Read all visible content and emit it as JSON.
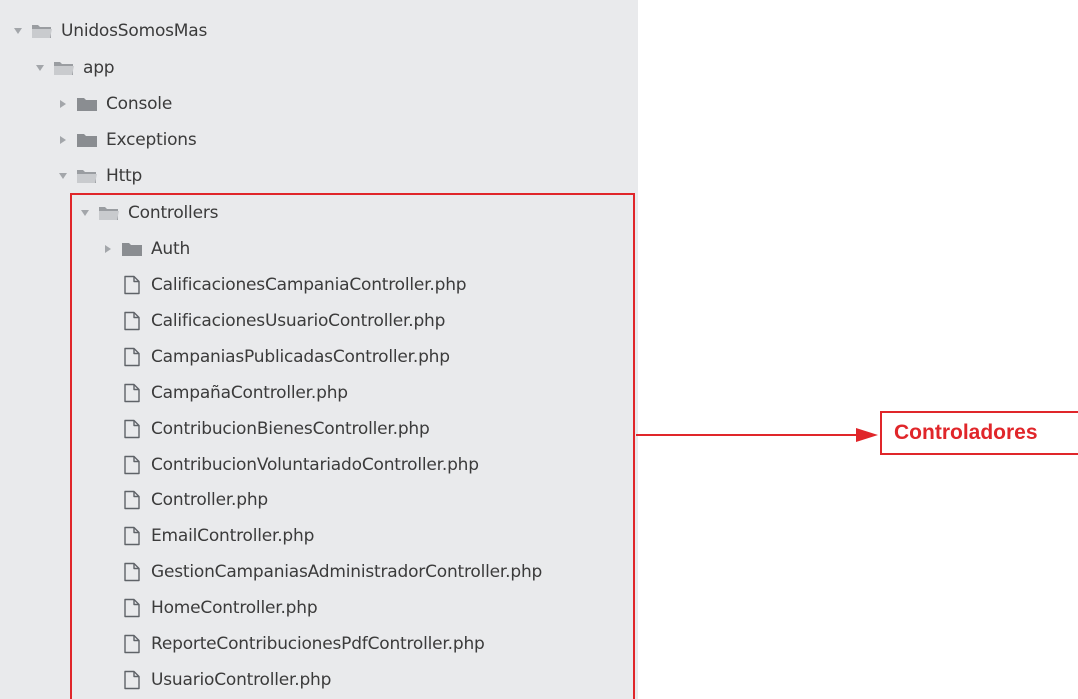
{
  "tree": {
    "root": {
      "label": "UnidosSomosMas",
      "state": "expanded",
      "icon": "folder-open-icon"
    },
    "app": {
      "label": "app",
      "state": "expanded",
      "icon": "folder-open-icon"
    },
    "console": {
      "label": "Console",
      "state": "collapsed",
      "icon": "folder-icon"
    },
    "exceptions": {
      "label": "Exceptions",
      "state": "collapsed",
      "icon": "folder-icon"
    },
    "http": {
      "label": "Http",
      "state": "expanded",
      "icon": "folder-open-icon"
    },
    "controllers": {
      "label": "Controllers",
      "state": "expanded",
      "icon": "folder-open-icon"
    },
    "auth": {
      "label": "Auth",
      "state": "collapsed",
      "icon": "folder-icon"
    },
    "files": [
      "CalificacionesCampaniaController.php",
      "CalificacionesUsuarioController.php",
      "CampaniasPublicadasController.php",
      "CampañaController.php",
      "ContribucionBienesController.php",
      "ContribucionVoluntariadoController.php",
      "Controller.php",
      "EmailController.php",
      "GestionCampaniasAdministradorController.php",
      "HomeController.php",
      "ReporteContribucionesPdfController.php",
      "UsuarioController.php"
    ]
  },
  "annotation": {
    "callout_label": "Controladores",
    "accent_color": "#e0262a"
  },
  "colors": {
    "panel_bg": "#e9eaec",
    "text": "#3b3b3b",
    "folder": "#8a8d91"
  }
}
